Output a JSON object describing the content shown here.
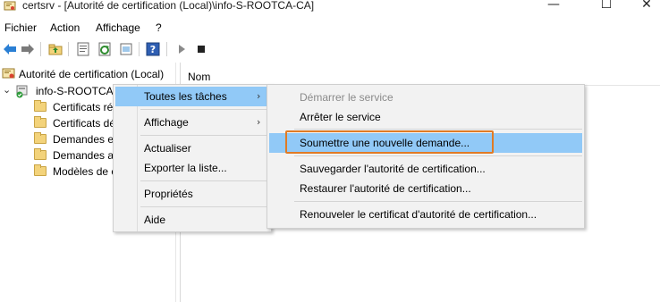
{
  "window": {
    "title": "certsrv - [Autorité de certification (Local)\\info-S-ROOTCA-CA]",
    "app_icon": "certsrv-icon",
    "controls": {
      "minimize": "—",
      "maximize": "☐",
      "close": "✕"
    }
  },
  "menubar": {
    "items": [
      "Fichier",
      "Action",
      "Affichage",
      "?"
    ]
  },
  "toolbar": {
    "buttons": [
      "back-arrow-icon",
      "forward-arrow-icon",
      "up-folder-icon",
      "properties-icon",
      "refresh-icon",
      "export-icon",
      "help-icon",
      "play-icon",
      "stop-icon"
    ]
  },
  "tree": {
    "root": "Autorité de certification (Local)",
    "ca_node": "info-S-ROOTCA-",
    "children": [
      "Certificats ré",
      "Certificats dé",
      "Demandes en",
      "Demandes ay",
      "Modèles de c"
    ]
  },
  "list": {
    "column_header": "Nom"
  },
  "context_menu": {
    "items": [
      "Toutes les tâches",
      "Affichage",
      "Actualiser",
      "Exporter la liste...",
      "Propriétés",
      "Aide"
    ],
    "submenu_arrow": "›"
  },
  "submenu": {
    "items": [
      {
        "label": "Démarrer le service",
        "disabled": true
      },
      {
        "label": "Arrêter le service"
      },
      {
        "label": "Soumettre une nouvelle demande...",
        "active": true
      },
      {
        "label": "Sauvegarder l'autorité de certification..."
      },
      {
        "label": "Restaurer l'autorité de certification..."
      },
      {
        "label": "Renouveler le certificat d'autorité de certification..."
      }
    ]
  },
  "colors": {
    "highlight": "#91c9f7",
    "callout_border": "#e07b25",
    "menu_bg": "#f2f2f2"
  }
}
